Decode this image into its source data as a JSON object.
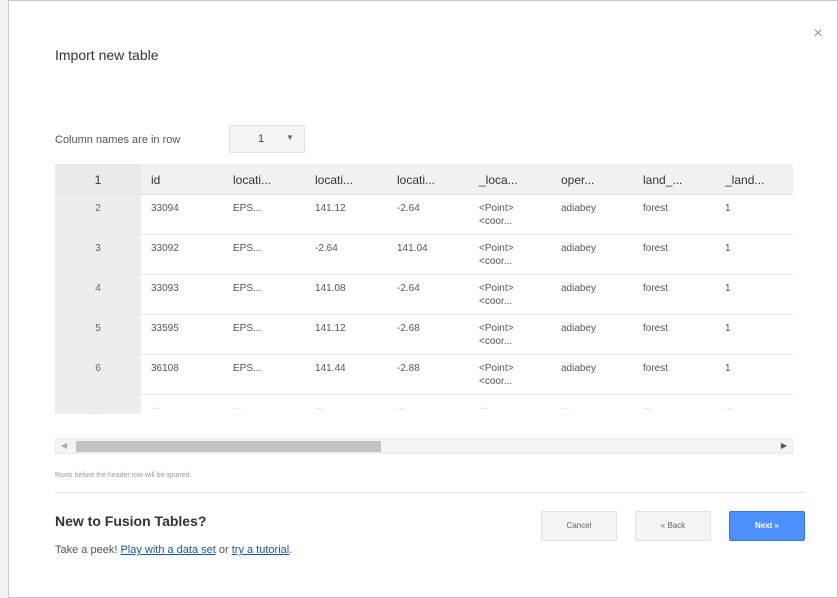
{
  "dialog": {
    "title": "Import new table",
    "close_glyph": "×"
  },
  "header_row_picker": {
    "label": "Column names are in row",
    "value": "1",
    "caret": "▼"
  },
  "grid": {
    "columns": [
      "1",
      "id",
      "locati...",
      "locati...",
      "locati...",
      "_loca...",
      "oper...",
      "land_...",
      "_land..."
    ],
    "rows": [
      [
        "2",
        "33094",
        "EPS...",
        "141.12",
        "-2.64",
        "<Point>\n<coor...",
        "adiabey",
        "forest",
        "1"
      ],
      [
        "3",
        "33092",
        "EPS...",
        "-2.64",
        "141.04",
        "<Point>\n<coor...",
        "adiabey",
        "forest",
        "1"
      ],
      [
        "4",
        "33093",
        "EPS...",
        "141.08",
        "-2.64",
        "<Point>\n<coor...",
        "adiabey",
        "forest",
        "1"
      ],
      [
        "5",
        "33595",
        "EPS...",
        "141.12",
        "-2.68",
        "<Point>\n<coor...",
        "adiabey",
        "forest",
        "1"
      ],
      [
        "6",
        "36108",
        "EPS...",
        "141.44",
        "-2.88",
        "<Point>\n<coor...",
        "adiabey",
        "forest",
        "1"
      ]
    ],
    "ellipsis": "..."
  },
  "scrollbar": {
    "left_arrow": "◀",
    "right_arrow": "▶"
  },
  "note": "Rows before the header row will be ignored.",
  "footer": {
    "heading": "New to Fusion Tables?",
    "peek_prefix": "Take a peek! ",
    "link_dataset": "Play with a data set",
    "peek_or": " or ",
    "link_tutorial": "try a tutorial",
    "peek_suffix": "."
  },
  "buttons": {
    "cancel": "Cancel",
    "back": "« Back",
    "next": "Next »"
  },
  "colors": {
    "primary_button": "#4d90fe",
    "link": "#1155cc"
  }
}
